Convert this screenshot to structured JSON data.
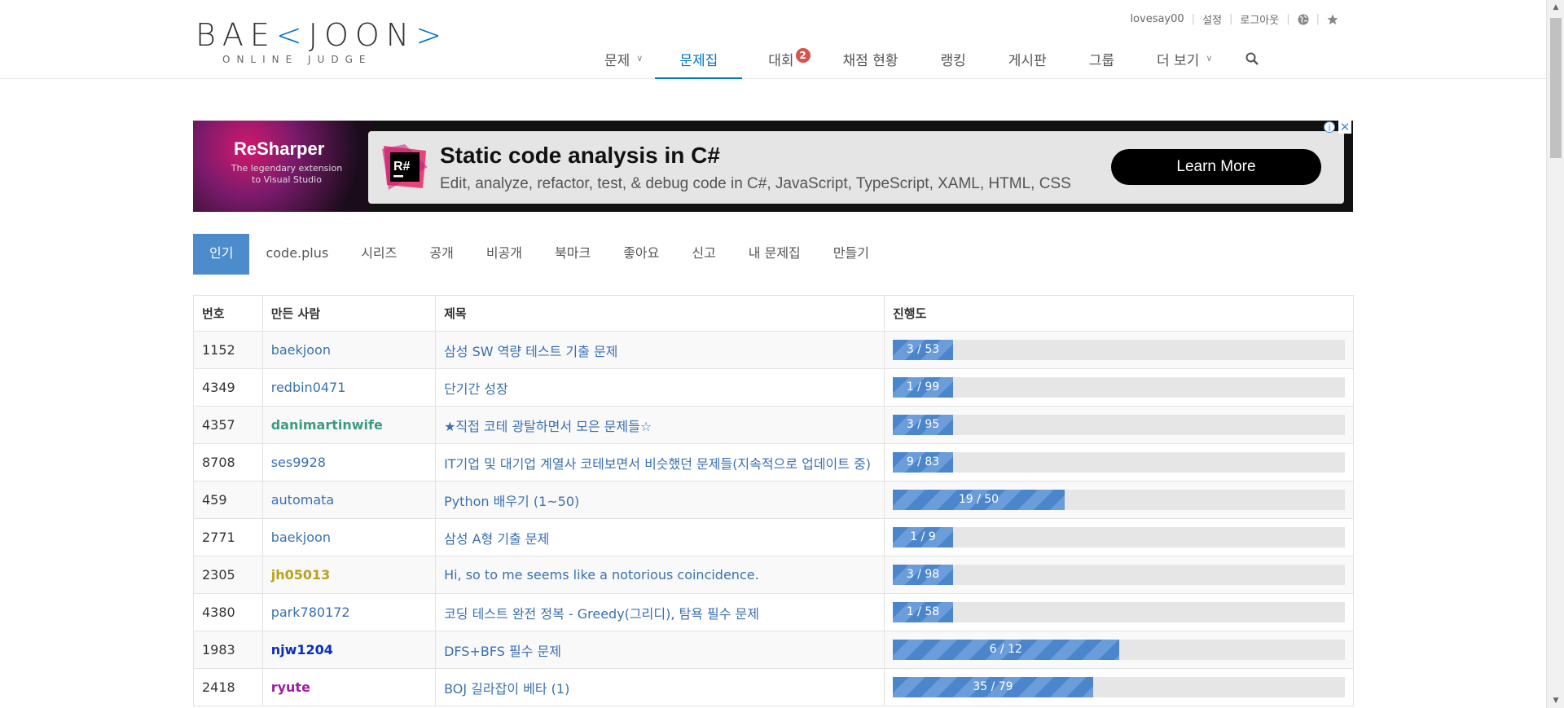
{
  "brand": {
    "logo_main_a": "BAE",
    "logo_main_lt": "<",
    "logo_main_b": "JOON",
    "logo_main_gt": ">",
    "logo_sub": "ONLINE JUDGE"
  },
  "toplinks": {
    "user": "lovesay00",
    "settings": "설정",
    "logout": "로그아웃",
    "globe_icon": "globe-icon",
    "star_icon": "star-icon"
  },
  "nav": {
    "problems": "문제",
    "workbook": "문제집",
    "contest": "대회",
    "contest_badge": "2",
    "status": "채점 현황",
    "ranking": "랭킹",
    "board": "게시판",
    "group": "그룹",
    "more": "더 보기"
  },
  "ad": {
    "left_title": "ReSharper",
    "left_sub": "The legendary extension to Visual Studio",
    "logo_text": "R#",
    "title": "Static code analysis in C#",
    "desc": "Edit, analyze, refactor, test, & debug code in C#, JavaScript, TypeScript, XAML, HTML, CSS",
    "button": "Learn More",
    "info": "i",
    "close": "✕"
  },
  "tabs": [
    "인기",
    "code.plus",
    "시리즈",
    "공개",
    "비공개",
    "북마크",
    "좋아요",
    "신고",
    "내 문제집",
    "만들기"
  ],
  "table": {
    "headers": {
      "num": "번호",
      "author": "만든 사람",
      "title": "제목",
      "progress": "진행도"
    },
    "rows": [
      {
        "num": "1152",
        "author": "baekjoon",
        "title": "삼성 SW 역량 테스트 기출 문제",
        "progress": "3 / 53",
        "solved": 3,
        "total": 53,
        "style": "link"
      },
      {
        "num": "4349",
        "author": "redbin0471",
        "title": "단기간 성장",
        "progress": "1 / 99",
        "solved": 1,
        "total": 99,
        "style": "link"
      },
      {
        "num": "4357",
        "author": "danimartinwife",
        "title": "★직접 코테 광탈하면서 모은 문제들☆",
        "progress": "3 / 95",
        "solved": 3,
        "total": 95,
        "style": "u-green"
      },
      {
        "num": "8708",
        "author": "ses9928",
        "title": "IT기업 및 대기업 계열사 코테보면서 비슷했던 문제들(지속적으로 업데이트 중)",
        "progress": "9 / 83",
        "solved": 9,
        "total": 83,
        "style": "link"
      },
      {
        "num": "459",
        "author": "automata",
        "title": "Python 배우기 (1~50)",
        "progress": "19 / 50",
        "solved": 19,
        "total": 50,
        "style": "link"
      },
      {
        "num": "2771",
        "author": "baekjoon",
        "title": "삼성 A형 기출 문제",
        "progress": "1 / 9",
        "solved": 1,
        "total": 9,
        "style": "link"
      },
      {
        "num": "2305",
        "author": "jh05013",
        "title": "Hi, so to me seems like a notorious coincidence.",
        "progress": "3 / 98",
        "solved": 3,
        "total": 98,
        "style": "u-gold"
      },
      {
        "num": "4380",
        "author": "park780172",
        "title": "코딩 테스트 완전 정복 - Greedy(그리디), 탐욕 필수 문제",
        "progress": "1 / 58",
        "solved": 1,
        "total": 58,
        "style": "link"
      },
      {
        "num": "1983",
        "author": "njw1204",
        "title": "DFS+BFS 필수 문제",
        "progress": "6 / 12",
        "solved": 6,
        "total": 12,
        "style": "u-navy"
      },
      {
        "num": "2418",
        "author": "ryute",
        "title": "BOJ 길라잡이 베타 (1)",
        "progress": "35 / 79",
        "solved": 35,
        "total": 79,
        "style": "u-purple"
      }
    ]
  }
}
